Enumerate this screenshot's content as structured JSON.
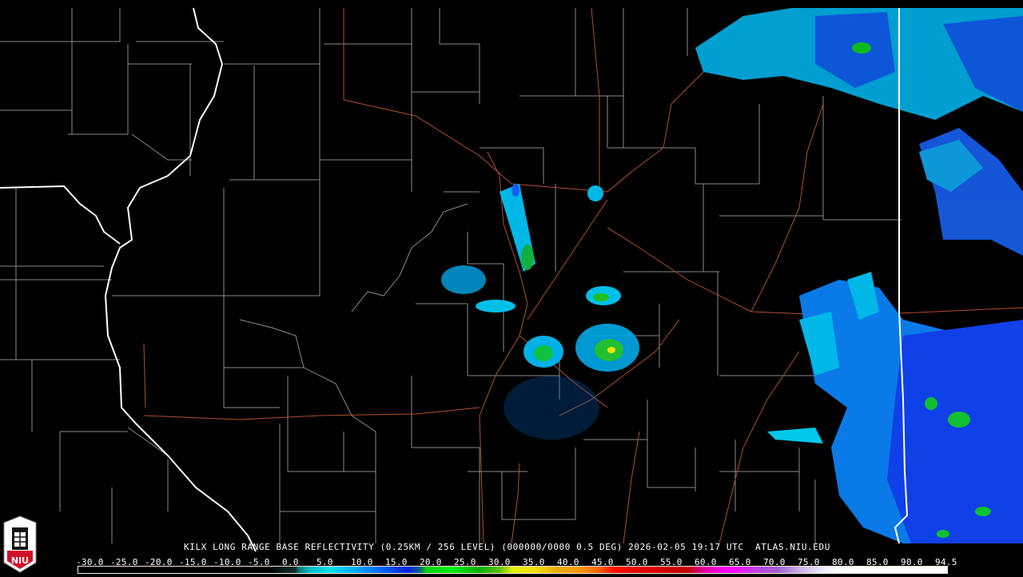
{
  "map": {
    "caption": "KILX LONG RANGE BASE REFLECTIVITY (0.25KM / 256 LEVEL) (000000/0000 0.5 DEG) 2026-02-05 19:17 UTC  ATLAS.NIU.EDU",
    "logo_text": "NIU",
    "colorbar_labels": [
      "-30.0",
      "-25.0",
      "-20.0",
      "-15.0",
      "-10.0",
      "-5.0",
      "0.0",
      "5.0",
      "10.0",
      "15.0",
      "20.0",
      "25.0",
      "30.0",
      "35.0",
      "40.0",
      "45.0",
      "50.0",
      "55.0",
      "60.0",
      "65.0",
      "70.0",
      "75.0",
      "80.0",
      "85.0",
      "90.0",
      "94.5"
    ],
    "colors": {
      "state_border": "#ffffff",
      "county_line": "#8a8a8a",
      "highway": "#b0502a",
      "light_echo": "#00c8e8",
      "moderate_echo": "#1060f0",
      "heavy_echo": "#10d020"
    }
  }
}
